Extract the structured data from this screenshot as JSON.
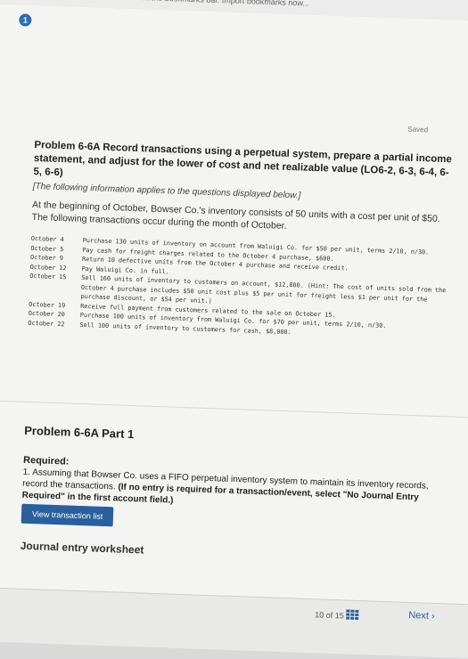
{
  "browser": {
    "bookmarks_hint": "...marks here on the bookmarks bar. Import bookmarks now..."
  },
  "status": {
    "saved": "Saved",
    "step": "1"
  },
  "problem": {
    "title": "Problem 6-6A Record transactions using a perpetual system, prepare a partial income statement, and adjust for the lower of cost and net realizable value (LO6-2, 6-3, 6-4, 6-5, 6-6)",
    "note": "[The following information applies to the questions displayed below.]",
    "intro": "At the beginning of October, Bowser Co.'s inventory consists of 50 units with a cost per unit of $50. The following transactions occur during the month of October.",
    "transactions": [
      {
        "date": "October  4",
        "desc": "Purchase 130 units of inventory on account from Waluigi Co. for $50 per unit, terms 2/10, n/30."
      },
      {
        "date": "October  5",
        "desc": "Pay cash for freight charges related to the October 4 purchase, $600."
      },
      {
        "date": "October  9",
        "desc": "Return 10 defective units from the October 4 purchase and receive credit."
      },
      {
        "date": "October 12",
        "desc": "Pay Waluigi Co. in full."
      },
      {
        "date": "October 15",
        "desc": "Sell 160 units of inventory to customers on account, $12,800. (Hint: The cost of units sold from the October 4 purchase includes $50 unit cost plus $5 per unit for freight less $1 per unit for the purchase discount, or $54 per unit.)"
      },
      {
        "date": "October 19",
        "desc": "Receive full payment from customers related to the sale on October 15."
      },
      {
        "date": "October 20",
        "desc": "Purchase 100 units of inventory from Waluigi Co. for $70 per unit, terms 2/10, n/30."
      },
      {
        "date": "October 22",
        "desc": "Sell 100 units of inventory to customers for cash, $8,000."
      }
    ]
  },
  "part": {
    "title": "Problem 6-6A Part 1",
    "required_label": "Required:",
    "required_text": "1. Assuming that Bowser Co. uses a FIFO perpetual inventory system to maintain its inventory records, record the transactions.",
    "required_bold": "(If no entry is required for a transaction/event, select \"No Journal Entry Required\" in the first account field.)",
    "view_button": "View transaction list",
    "journal_title": "Journal entry worksheet"
  },
  "footer": {
    "pager": "10   of 15",
    "next": "Next"
  }
}
